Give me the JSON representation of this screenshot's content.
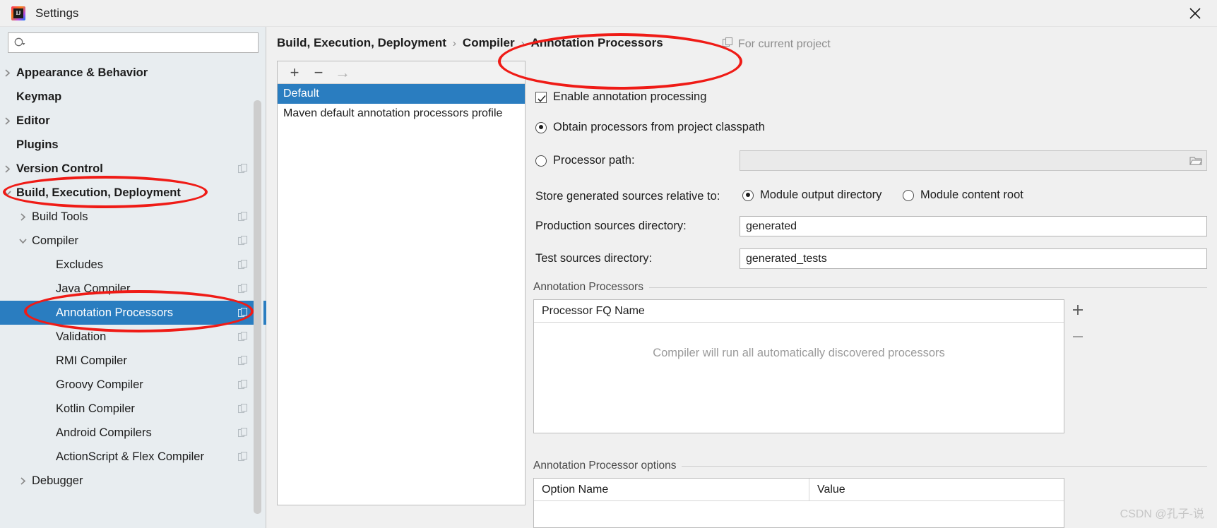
{
  "window": {
    "title": "Settings",
    "app_icon": "intellij-idea-icon",
    "close_label": "✕"
  },
  "sidebar": {
    "search": {
      "value": "",
      "placeholder": "",
      "icon": "search-icon"
    },
    "items": [
      {
        "label": "Appearance & Behavior",
        "indent": 0,
        "arrow": "right",
        "bold": true,
        "copy": false,
        "selected": false
      },
      {
        "label": "Keymap",
        "indent": 0,
        "arrow": "none",
        "bold": true,
        "copy": false,
        "selected": false
      },
      {
        "label": "Editor",
        "indent": 0,
        "arrow": "right",
        "bold": true,
        "copy": false,
        "selected": false
      },
      {
        "label": "Plugins",
        "indent": 0,
        "arrow": "none",
        "bold": true,
        "copy": false,
        "selected": false
      },
      {
        "label": "Version Control",
        "indent": 0,
        "arrow": "right",
        "bold": true,
        "copy": true,
        "selected": false
      },
      {
        "label": "Build, Execution, Deployment",
        "indent": 0,
        "arrow": "down",
        "bold": true,
        "copy": false,
        "selected": false
      },
      {
        "label": "Build Tools",
        "indent": 1,
        "arrow": "right",
        "bold": false,
        "copy": true,
        "selected": false
      },
      {
        "label": "Compiler",
        "indent": 1,
        "arrow": "down",
        "bold": false,
        "copy": true,
        "selected": false
      },
      {
        "label": "Excludes",
        "indent": 2,
        "arrow": "none",
        "bold": false,
        "copy": true,
        "selected": false
      },
      {
        "label": "Java Compiler",
        "indent": 2,
        "arrow": "none",
        "bold": false,
        "copy": true,
        "selected": false
      },
      {
        "label": "Annotation Processors",
        "indent": 2,
        "arrow": "none",
        "bold": false,
        "copy": true,
        "selected": true
      },
      {
        "label": "Validation",
        "indent": 2,
        "arrow": "none",
        "bold": false,
        "copy": true,
        "selected": false
      },
      {
        "label": "RMI Compiler",
        "indent": 2,
        "arrow": "none",
        "bold": false,
        "copy": true,
        "selected": false
      },
      {
        "label": "Groovy Compiler",
        "indent": 2,
        "arrow": "none",
        "bold": false,
        "copy": true,
        "selected": false
      },
      {
        "label": "Kotlin Compiler",
        "indent": 2,
        "arrow": "none",
        "bold": false,
        "copy": true,
        "selected": false
      },
      {
        "label": "Android Compilers",
        "indent": 2,
        "arrow": "none",
        "bold": false,
        "copy": true,
        "selected": false
      },
      {
        "label": "ActionScript & Flex Compiler",
        "indent": 2,
        "arrow": "none",
        "bold": false,
        "copy": true,
        "selected": false
      },
      {
        "label": "Debugger",
        "indent": 1,
        "arrow": "right",
        "bold": false,
        "copy": false,
        "selected": false
      }
    ]
  },
  "breadcrumb": {
    "parts": [
      "Build, Execution, Deployment",
      "Compiler",
      "Annotation Processors"
    ],
    "separator": "›"
  },
  "scope": {
    "label": "For current project",
    "icon": "project-scope-icon"
  },
  "profiles": {
    "toolbar": [
      {
        "name": "add-profile-button",
        "icon": "plus-icon",
        "glyph": "+",
        "enabled": true
      },
      {
        "name": "remove-profile-button",
        "icon": "minus-icon",
        "glyph": "−",
        "enabled": true
      },
      {
        "name": "move-profile-button",
        "icon": "arrow-right-icon",
        "glyph": "→",
        "enabled": false
      }
    ],
    "rows": [
      {
        "label": "Default",
        "selected": true
      },
      {
        "label": "Maven default annotation processors profile",
        "selected": false
      }
    ]
  },
  "settings": {
    "enable_annotation_processing": {
      "label": "Enable annotation processing",
      "checked": true
    },
    "source_mode": {
      "options": [
        {
          "label": "Obtain processors from project classpath",
          "selected": true
        },
        {
          "label": "Processor path:",
          "selected": false
        }
      ],
      "processor_path_value": "",
      "processor_path_browse_icon": "folder-browse-icon"
    },
    "store_generated": {
      "label": "Store generated sources relative to:",
      "options": [
        {
          "label": "Module output directory",
          "selected": true
        },
        {
          "label": "Module content root",
          "selected": false
        }
      ]
    },
    "production_sources": {
      "label": "Production sources directory:",
      "value": "generated"
    },
    "test_sources": {
      "label": "Test sources directory:",
      "value": "generated_tests"
    },
    "processors_group": {
      "title": "Annotation Processors",
      "column": "Processor FQ Name",
      "empty_message": "Compiler will run all automatically discovered processors",
      "add_icon": "plus-icon",
      "remove_icon": "minus-icon",
      "add_glyph": "+",
      "remove_glyph": "−"
    },
    "options_group": {
      "title": "Annotation Processor options",
      "columns": [
        "Option Name",
        "Value"
      ]
    }
  },
  "annotations": {
    "ellipses": [
      "breadcrumb-and-enable-checkbox",
      "build-execution-deployment-tree-item",
      "annotation-processors-tree-item"
    ]
  },
  "watermark": {
    "text": "CSDN @孔子-说"
  },
  "colors": {
    "accent": "#2a7dc0",
    "sidebar_bg": "#e8edf0",
    "panel_bg": "#f0f0f0",
    "annotation_red": "#ef1b16"
  }
}
